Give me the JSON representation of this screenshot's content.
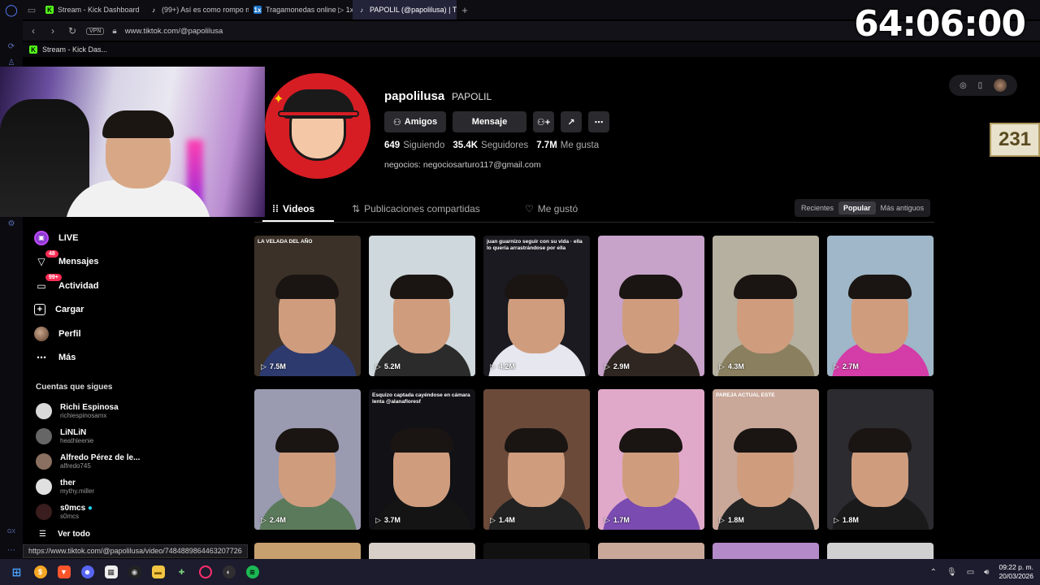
{
  "browser": {
    "tabs": [
      {
        "title": "Stream - Kick Dashboard",
        "fav": "K",
        "color": "#53fc18"
      },
      {
        "title": "(99+) Así es como rompo m",
        "fav": "♪",
        "color": "#111111"
      },
      {
        "title": "Tragamonedas online ▷ 1x",
        "fav": "1x",
        "color": "#1a73c8"
      },
      {
        "title": "PAPOLIL (@papolilusa) | Ti",
        "fav": "♪",
        "color": "#111111"
      }
    ],
    "vpn_label": "VPN",
    "url": "www.tiktok.com/@papolilusa",
    "bookmark": "Stream - Kick Das..."
  },
  "overlay": {
    "timer": "64:06:00",
    "counter": "231"
  },
  "nav": {
    "items": [
      {
        "label": "LIVE",
        "icon": "live-icon",
        "badge": ""
      },
      {
        "label": "Mensajes",
        "icon": "send-icon",
        "badge": "48"
      },
      {
        "label": "Actividad",
        "icon": "inbox-icon",
        "badge": "99+"
      },
      {
        "label": "Cargar",
        "icon": "upload-icon",
        "badge": ""
      },
      {
        "label": "Perfil",
        "icon": "profile-avatar-icon",
        "badge": ""
      },
      {
        "label": "Más",
        "icon": "more-icon",
        "badge": ""
      }
    ],
    "following_title": "Cuentas que sigues",
    "following": [
      {
        "name": "Richi Espinosa",
        "handle": "richiespinosamx",
        "color": "#d9d9d9"
      },
      {
        "name": "LiNLiN",
        "handle": "heathleenie",
        "color": "#666666"
      },
      {
        "name": "Alfredo Pérez de le...",
        "handle": "alfredo745",
        "color": "#8a7060"
      },
      {
        "name": "ther",
        "handle": "mythy.miller",
        "color": "#e0e0e0"
      },
      {
        "name": "s0mcs",
        "handle": "s0mcs",
        "color": "#3a1d1d"
      }
    ],
    "see_all": "Ver todo"
  },
  "profile": {
    "username": "papolilusa",
    "display_name": "PAPOLIL",
    "btn_friends": "Amigos",
    "btn_message": "Mensaje",
    "following_count": "649",
    "following_label": "Siguiendo",
    "followers_count": "35.4K",
    "followers_label": "Seguidores",
    "likes_count": "7.7M",
    "likes_label": "Me gusta",
    "bio": "negocios: negociosarturo117@gmail.com"
  },
  "tabs": {
    "videos": "Videos",
    "reposts": "Publicaciones compartidas",
    "liked": "Me gustó",
    "sort": [
      "Recientes",
      "Popular",
      "Más antiguos"
    ],
    "sort_active": 1
  },
  "videos": [
    {
      "views": "7.5M",
      "bg": "#3b3128",
      "body": "#2d3a6e",
      "caption": "LA VELADA DEL AÑO"
    },
    {
      "views": "5.2M",
      "bg": "#cfd8dc",
      "body": "#2b2b2b",
      "caption": ""
    },
    {
      "views": "4.2M",
      "bg": "#1a1a20",
      "body": "#e7e7ef",
      "caption": "juan guarnizo seguir con su vida · ella lo quería arrastrándose por ella"
    },
    {
      "views": "2.9M",
      "bg": "#c7a2c9",
      "body": "#2f2622",
      "caption": ""
    },
    {
      "views": "4.3M",
      "bg": "#b5b0a0",
      "body": "#8a8060",
      "caption": ""
    },
    {
      "views": "2.7M",
      "bg": "#9fb7c8",
      "body": "#d43ca8",
      "caption": ""
    },
    {
      "views": "2.4M",
      "bg": "#9a9ab0",
      "body": "#5b7a5b",
      "caption": ""
    },
    {
      "views": "3.7M",
      "bg": "#111116",
      "body": "#141414",
      "caption": "Esquizo captada cayéndose en cámara lenta @alanafloresf"
    },
    {
      "views": "1.4M",
      "bg": "#6b4a3a",
      "body": "#222222",
      "caption": ""
    },
    {
      "views": "1.7M",
      "bg": "#e1a9c9",
      "body": "#7a4bb0",
      "caption": ""
    },
    {
      "views": "1.8M",
      "bg": "#c9a89a",
      "body": "#232323",
      "caption": "PAREJA ACTUAL ESTE"
    },
    {
      "views": "1.8M",
      "bg": "#2b2b30",
      "body": "#1a1a1a",
      "caption": ""
    }
  ],
  "status_link": "https://www.tiktok.com/@papolilusa/video/7484889864463207726",
  "taskbar": {
    "time": "09:22 p. m.",
    "date": "20/03/2026"
  },
  "colors": {
    "accent": "#fe2c55",
    "panel": "#2a2a2e"
  }
}
